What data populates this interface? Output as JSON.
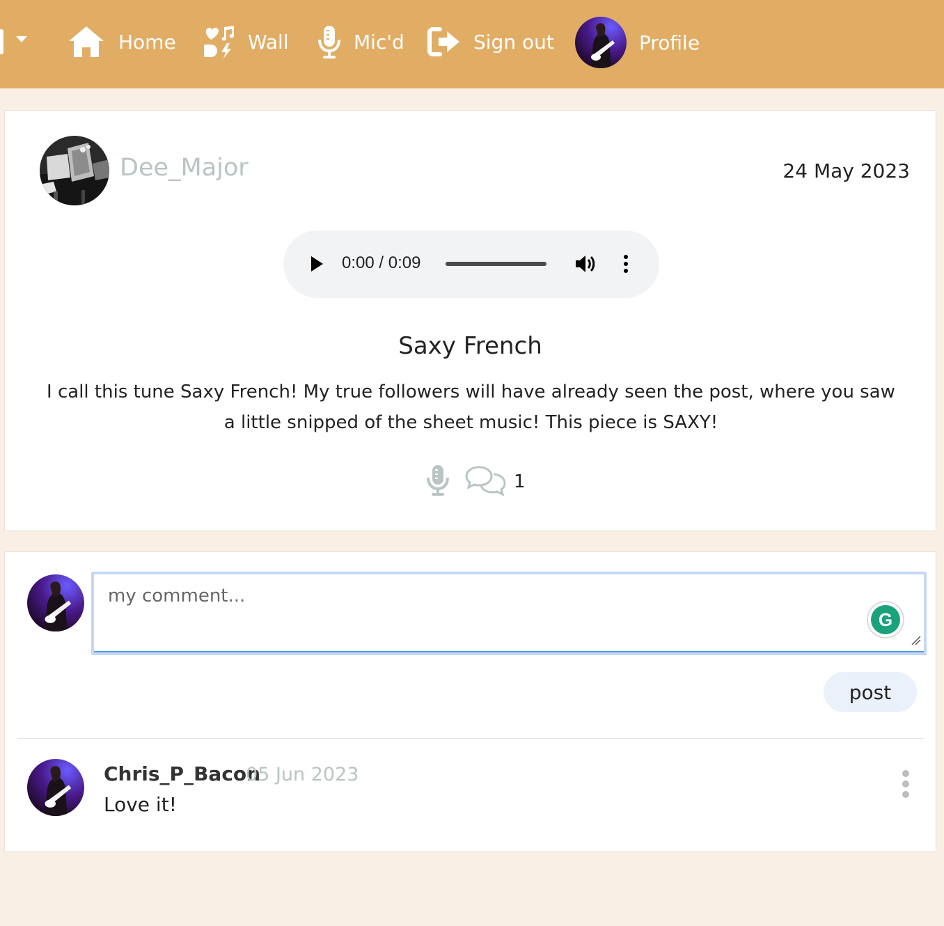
{
  "navbar": {
    "bg_color": "#e1ad64",
    "items": [
      {
        "label": "Home",
        "icon": "home-icon"
      },
      {
        "label": "Wall",
        "icon": "wall-icon"
      },
      {
        "label": "Mic'd",
        "icon": "microphone-icon"
      },
      {
        "label": "Sign out",
        "icon": "sign-out-icon"
      },
      {
        "label": "Profile",
        "icon": "avatar"
      }
    ]
  },
  "post": {
    "author": "Dee_Major",
    "date": "24 May 2023",
    "audio": {
      "time": "0:00 / 0:09"
    },
    "title": "Saxy French",
    "body": "I call this tune Saxy French! My true followers will have already seen the post, where you saw a little snipped of the sheet music! This piece is SAXY!",
    "comment_count": "1"
  },
  "comment_form": {
    "placeholder": "my comment...",
    "grammarly_letter": "G",
    "post_label": "post"
  },
  "comments": [
    {
      "author": "Chris_P_Bacon",
      "date": "05 Jun 2023",
      "text": "Love it!"
    }
  ]
}
